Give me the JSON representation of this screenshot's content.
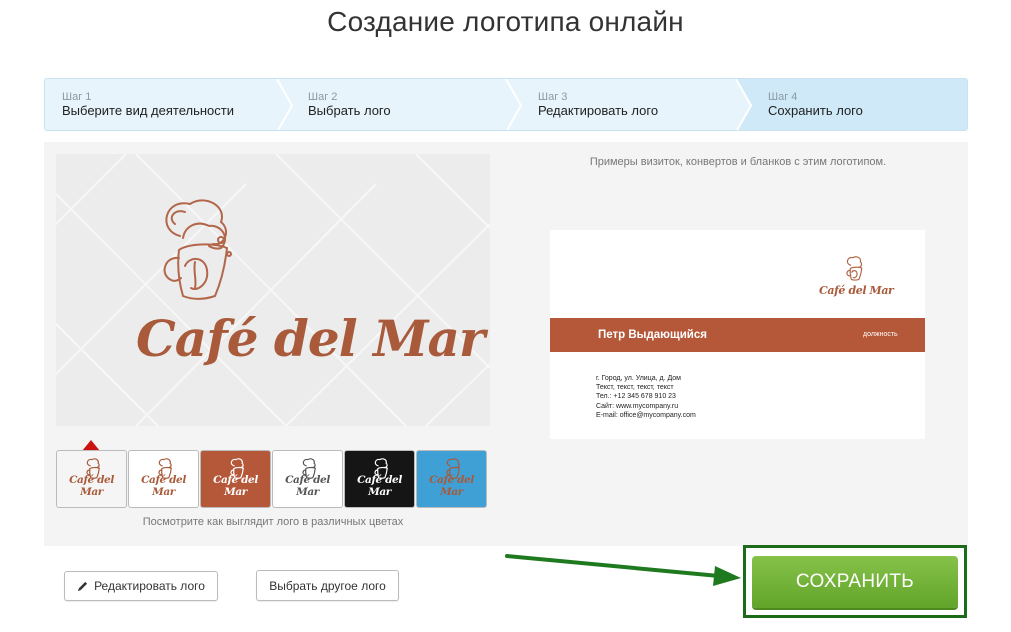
{
  "page": {
    "title": "Создание логотипа онлайн"
  },
  "steps": [
    {
      "num": "Шаг 1",
      "label": "Выберите вид деятельности"
    },
    {
      "num": "Шаг 2",
      "label": "Выбрать лого"
    },
    {
      "num": "Шаг 3",
      "label": "Редактировать лого"
    },
    {
      "num": "Шаг 4",
      "label": "Сохранить лого"
    }
  ],
  "logo": {
    "name": "Café del Mar",
    "color": "#a85a3a"
  },
  "swatches": {
    "note": "Посмотрите как выглядит лого в различных цветах",
    "items": [
      {
        "bg": "#f5f5f5",
        "fg": "#a85a3a"
      },
      {
        "bg": "#ffffff",
        "fg": "#a85a3a"
      },
      {
        "bg": "#b5583a",
        "fg": "#ffffff"
      },
      {
        "bg": "#ffffff",
        "fg": "#555555"
      },
      {
        "bg": "#151515",
        "fg": "#ffffff"
      },
      {
        "bg": "#3fa0d6",
        "fg": "#a85a3a"
      }
    ]
  },
  "samples": {
    "note": "Примеры визиток, конвертов и бланков с этим логотипом."
  },
  "card": {
    "name": "Петр Выдающийся",
    "position": "должность",
    "contacts": [
      "г. Город, ул. Улица, д. Дом",
      "Текст, текст, текст, текст",
      "Тел.: +12 345 678 910 23",
      "Сайт: www.mycompany.ru",
      "E-mail: office@mycompany.com"
    ]
  },
  "actions": {
    "edit": "Редактировать лого",
    "other": "Выбрать другое лого",
    "save": "СОХРАНИТЬ"
  },
  "icons": {
    "edit": "pencil-icon"
  }
}
